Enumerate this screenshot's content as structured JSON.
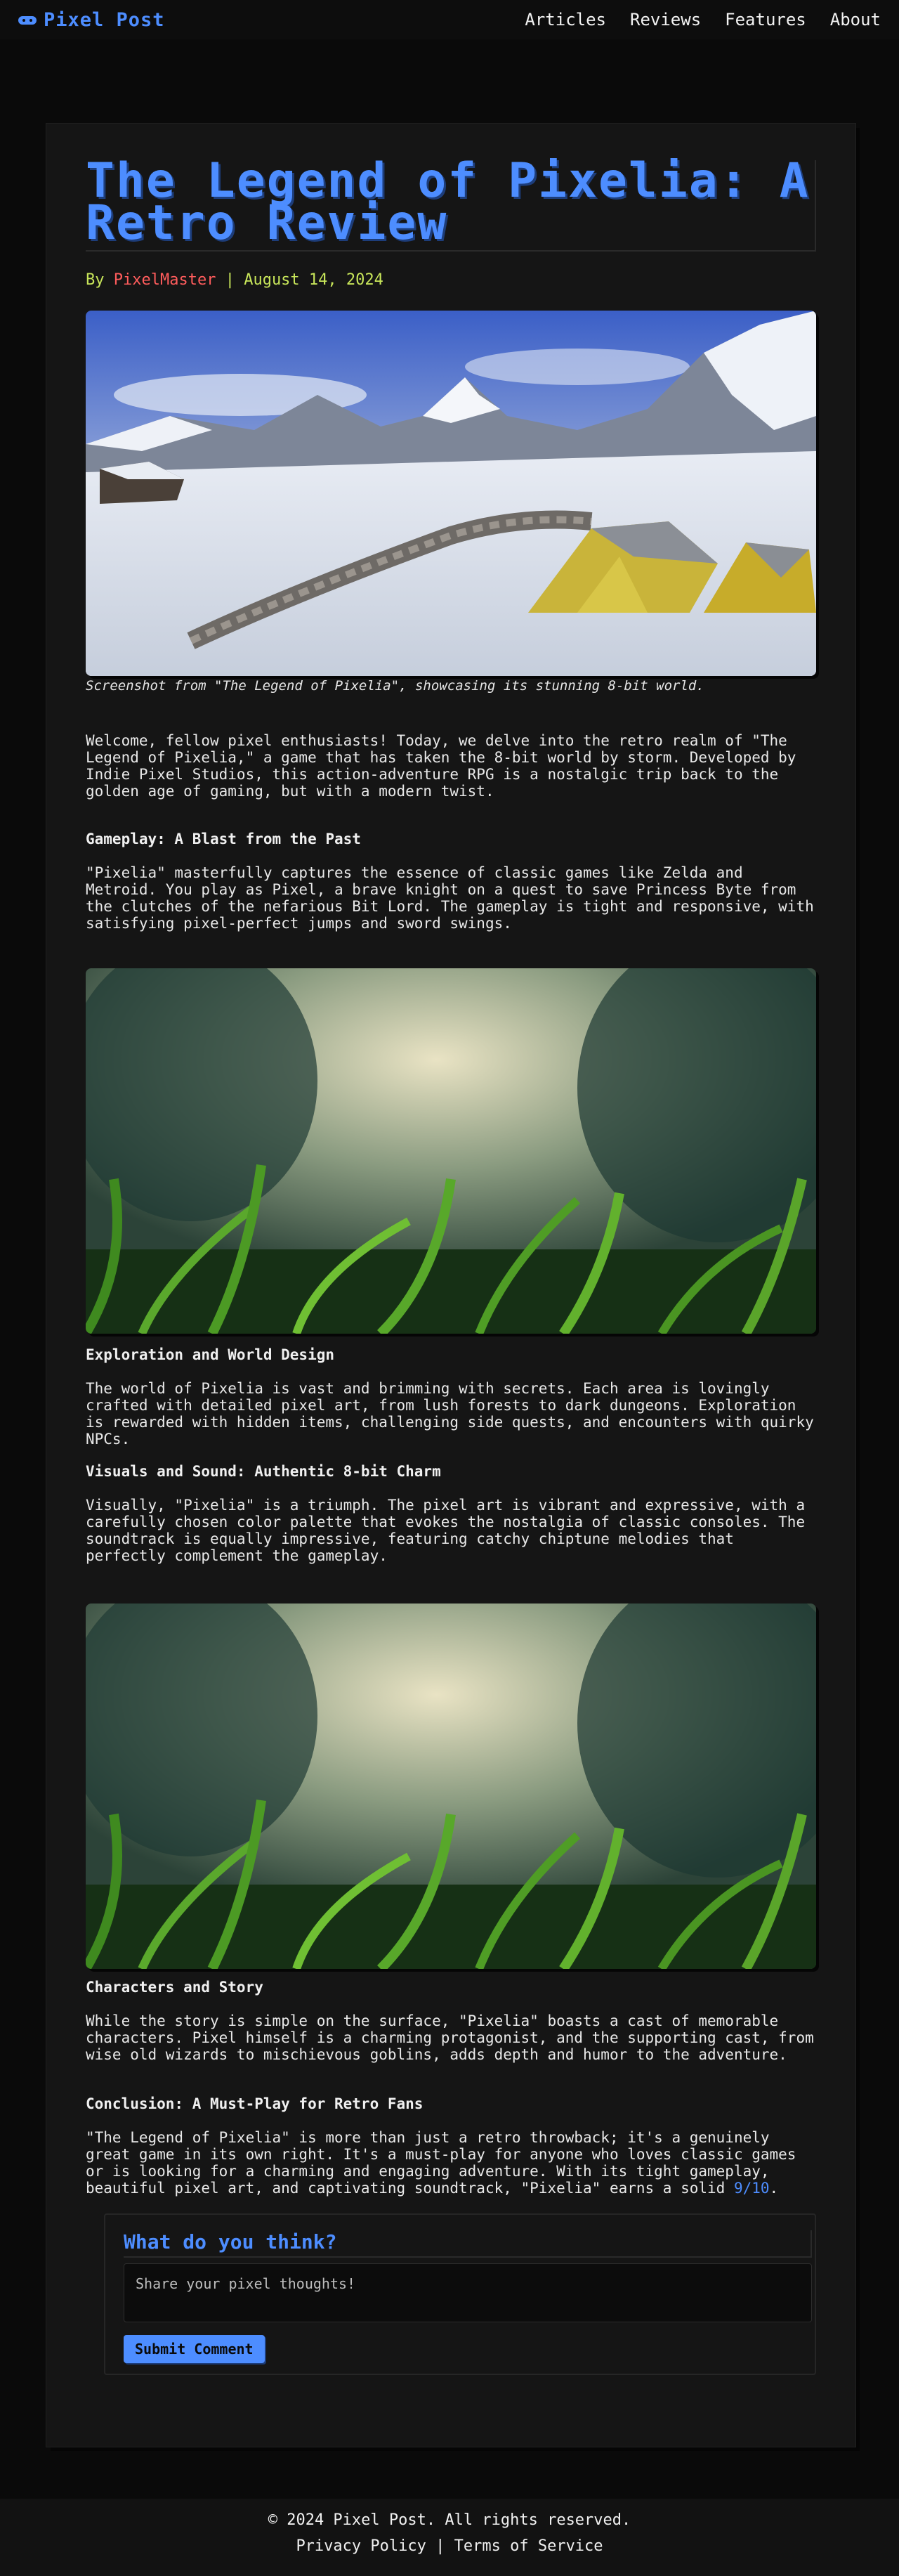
{
  "header": {
    "brand": "Pixel Post",
    "nav": [
      "Articles",
      "Reviews",
      "Features",
      "About"
    ]
  },
  "article": {
    "title": "The Legend of Pixelia: A Retro Review",
    "byline_prefix": "By ",
    "author": "PixelMaster",
    "byline_sep": " | ",
    "date": "August 14, 2024",
    "caption": "Screenshot from \"The Legend of Pixelia\", showcasing its stunning 8-bit world.",
    "intro": "Welcome, fellow pixel enthusiasts! Today, we delve into the retro realm of \"The Legend of Pixelia,\" a game that has taken the 8-bit world by storm. Developed by Indie Pixel Studios, this action-adventure RPG is a nostalgic trip back to the golden age of gaming, but with a modern twist.",
    "h_gameplay": "Gameplay: A Blast from the Past",
    "p_gameplay": "\"Pixelia\" masterfully captures the essence of classic games like Zelda and Metroid. You play as Pixel, a brave knight on a quest to save Princess Byte from the clutches of the nefarious Bit Lord. The gameplay is tight and responsive, with satisfying pixel-perfect jumps and sword swings.",
    "h_exploration": "Exploration and World Design",
    "p_exploration": "The world of Pixelia is vast and brimming with secrets. Each area is lovingly crafted with detailed pixel art, from lush forests to dark dungeons. Exploration is rewarded with hidden items, challenging side quests, and encounters with quirky NPCs.",
    "h_visuals": "Visuals and Sound: Authentic 8-bit Charm",
    "p_visuals": "Visually, \"Pixelia\" is a triumph. The pixel art is vibrant and expressive, with a carefully chosen color palette that evokes the nostalgia of classic consoles. The soundtrack is equally impressive, featuring catchy chiptune melodies that perfectly complement the gameplay.",
    "h_characters": "Characters and Story",
    "p_characters": "While the story is simple on the surface, \"Pixelia\" boasts a cast of memorable characters. Pixel himself is a charming protagonist, and the supporting cast, from wise old wizards to mischievous goblins, adds depth and humor to the adventure.",
    "h_conclusion": "Conclusion: A Must-Play for Retro Fans",
    "p_conclusion": "\"The Legend of Pixelia\" is more than just a retro throwback; it's a genuinely great game in its own right. It's a must-play for anyone who loves classic games or is looking for a charming and engaging adventure. With its tight gameplay, beautiful pixel art, and captivating soundtrack, \"Pixelia\" earns a solid ",
    "score": "9/10",
    "score_suffix": "."
  },
  "comments": {
    "title": "What do you think?",
    "placeholder": "Share your pixel thoughts!",
    "submit": "Submit Comment"
  },
  "footer": {
    "copyright": "© 2024 Pixel Post. All rights reserved.",
    "privacy": "Privacy Policy",
    "sep": " | ",
    "terms": "Terms of Service"
  },
  "colors": {
    "accent": "#4d8dff",
    "author": "#ff5c5c",
    "date": "#c8e65a",
    "background": "#0a0a0a",
    "card": "#151515"
  },
  "icons": {
    "brand": "gamepad-icon"
  }
}
